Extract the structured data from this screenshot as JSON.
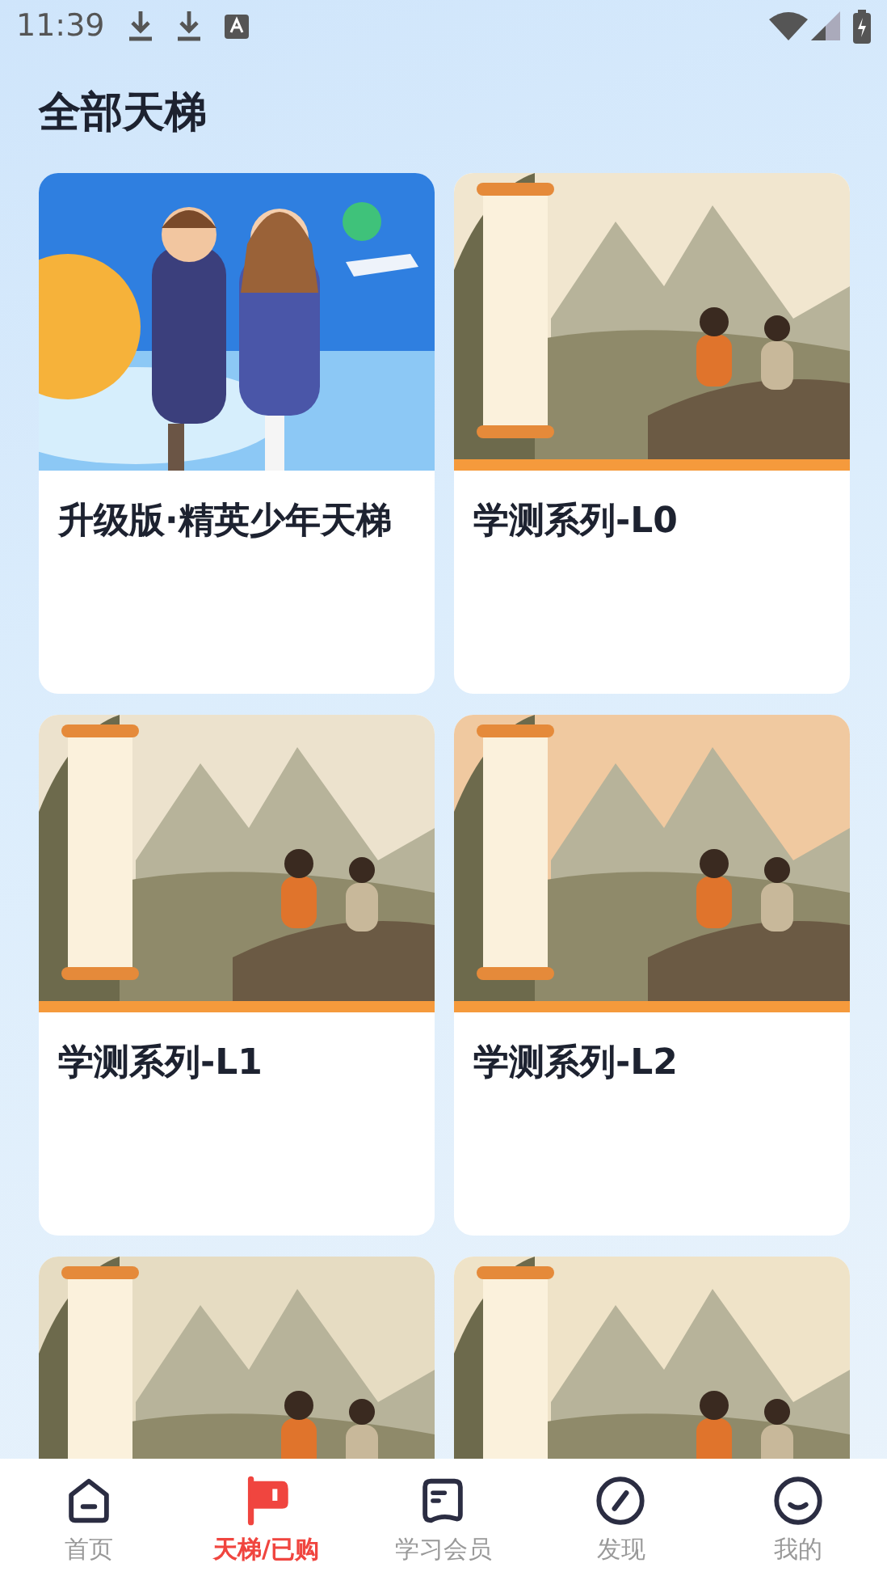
{
  "status_bar": {
    "time": "11:39"
  },
  "page_title": "全部天梯",
  "cards": [
    {
      "title": "升级版·精英少年天梯",
      "picture": {
        "kind": "picture"
      }
    },
    {
      "title": "学测系列-L0",
      "picture": {
        "kind": "picture"
      }
    },
    {
      "title": "学测系列-L1",
      "picture": {
        "kind": "picture"
      }
    },
    {
      "title": "学测系列-L2",
      "picture": {
        "kind": "picture"
      }
    },
    {
      "picture": {
        "kind": "picture"
      }
    },
    {
      "picture": {
        "kind": "picture"
      }
    }
  ],
  "bottom_nav": [
    {
      "label": "首页",
      "selected": false
    },
    {
      "label": "天梯/已购",
      "selected": true
    },
    {
      "label": "学习会员",
      "selected": false
    },
    {
      "label": "发现",
      "selected": false
    },
    {
      "label": "我的",
      "selected": false
    }
  ]
}
